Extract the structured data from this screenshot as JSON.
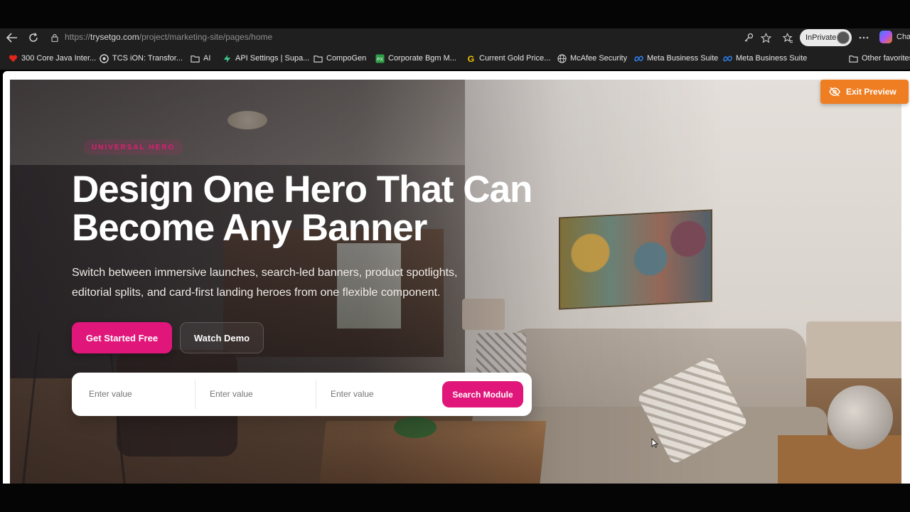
{
  "browser": {
    "url_prefix": "https://",
    "url_host": "trysetgo.com",
    "url_path": "/project/marketing-site/pages/home",
    "inprivate_label": "InPrivate",
    "chat_label": "Cha",
    "bookmarks": [
      {
        "label": "300 Core Java Inter...",
        "icon": "heart-icon"
      },
      {
        "label": "TCS iON: Transfor...",
        "icon": "tcs-icon"
      },
      {
        "label": "AI",
        "icon": "folder-icon"
      },
      {
        "label": "API Settings | Supa...",
        "icon": "supabase-icon"
      },
      {
        "label": "CompoGen",
        "icon": "folder-icon"
      },
      {
        "label": "Corporate Bgm M...",
        "icon": "px-icon"
      },
      {
        "label": "Current Gold Price...",
        "icon": "g-icon"
      },
      {
        "label": "McAfee Security",
        "icon": "globe-icon"
      },
      {
        "label": "Meta Business Suite",
        "icon": "meta-icon"
      },
      {
        "label": "Meta Business Suite",
        "icon": "meta-icon"
      },
      {
        "label": "Other favorites",
        "icon": "folder-icon"
      }
    ]
  },
  "preview": {
    "exit_label": "Exit Preview"
  },
  "hero": {
    "eyebrow": "UNIVERSAL HERO",
    "title_line1": "Design One Hero That Can",
    "title_line2": "Become Any Banner",
    "subtitle_line1": "Switch between immersive launches, search-led banners, product spotlights,",
    "subtitle_line2": "editorial splits, and card-first landing heroes from one flexible component.",
    "primary_cta": "Get Started Free",
    "secondary_cta": "Watch Demo",
    "search": {
      "field1_placeholder": "Enter value",
      "field2_placeholder": "Enter value",
      "field3_placeholder": "Enter value",
      "button_label": "Search Module"
    }
  },
  "colors": {
    "accent": "#e0167a",
    "exit_button": "#ef7d22"
  }
}
